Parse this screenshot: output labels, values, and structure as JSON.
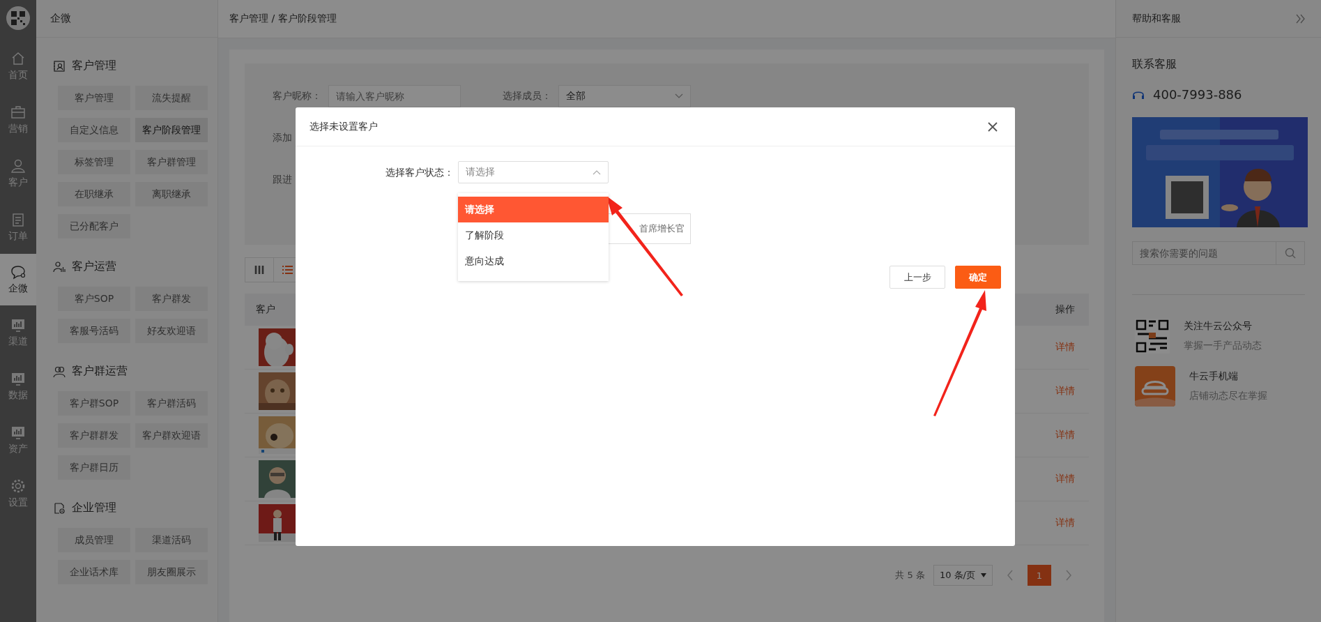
{
  "nav": {
    "items": [
      {
        "label": "首页",
        "selected": false
      },
      {
        "label": "营销",
        "selected": false
      },
      {
        "label": "客户",
        "selected": false
      },
      {
        "label": "订单",
        "selected": false
      },
      {
        "label": "企微",
        "selected": true
      },
      {
        "label": "渠道",
        "selected": false
      },
      {
        "label": "数据",
        "selected": false
      },
      {
        "label": "资产",
        "selected": false
      },
      {
        "label": "设置",
        "selected": false
      }
    ]
  },
  "sidebar": {
    "title": "企微",
    "sections": [
      {
        "title": "客户管理",
        "items": [
          {
            "label": "客户管理",
            "selected": false
          },
          {
            "label": "流失提醒",
            "selected": false
          },
          {
            "label": "自定义信息",
            "selected": false
          },
          {
            "label": "客户阶段管理",
            "selected": true
          },
          {
            "label": "标签管理",
            "selected": false
          },
          {
            "label": "客户群管理",
            "selected": false
          },
          {
            "label": "在职继承",
            "selected": false
          },
          {
            "label": "离职继承",
            "selected": false
          },
          {
            "label": "已分配客户",
            "selected": false
          }
        ]
      },
      {
        "title": "客户运营",
        "items": [
          {
            "label": "客户SOP",
            "selected": false
          },
          {
            "label": "客户群发",
            "selected": false
          },
          {
            "label": "客服号活码",
            "selected": false
          },
          {
            "label": "好友欢迎语",
            "selected": false
          }
        ]
      },
      {
        "title": "客户群运营",
        "items": [
          {
            "label": "客户群SOP",
            "selected": false
          },
          {
            "label": "客户群活码",
            "selected": false
          },
          {
            "label": "客户群群发",
            "selected": false
          },
          {
            "label": "客户群欢迎语",
            "selected": false
          },
          {
            "label": "客户群日历",
            "selected": false
          }
        ]
      },
      {
        "title": "企业管理",
        "items": [
          {
            "label": "成员管理",
            "selected": false
          },
          {
            "label": "渠道活码",
            "selected": false
          },
          {
            "label": "企业话术库",
            "selected": false
          },
          {
            "label": "朋友圈展示",
            "selected": false
          }
        ]
      }
    ]
  },
  "breadcrumb": "客户管理 / 客户阶段管理",
  "filters": [
    {
      "kind": "input",
      "label": "客户昵称：",
      "placeholder": "请输入客户昵称"
    },
    {
      "kind": "select",
      "label": "选择成员：",
      "value": "全部"
    },
    {
      "kind": "label",
      "label": "添加"
    },
    {
      "kind": "label",
      "label": "跟进"
    }
  ],
  "view_toggle": [
    {
      "selected": false
    },
    {
      "selected": true
    }
  ],
  "table": {
    "columns": [
      "客户",
      "操作"
    ],
    "rows": [
      {
        "action": "详情"
      },
      {
        "action": "详情"
      },
      {
        "action": "详情"
      },
      {
        "action": "详情"
      },
      {
        "action": "详情"
      }
    ]
  },
  "pagination": {
    "total": "共 5 条",
    "page_size": "10 条/页",
    "pages": [
      {
        "label": "1",
        "selected": true
      }
    ]
  },
  "help_panel": {
    "title": "帮助和客服",
    "contact_title": "联系客服",
    "phone": "400-7993-886",
    "search": {
      "placeholder": "搜索你需要的问题"
    },
    "links": [
      {
        "title": "关注牛云公众号",
        "subtitle": "掌握一手产品动态"
      },
      {
        "title": "牛云手机端",
        "subtitle": "店铺动态尽在掌握"
      }
    ]
  },
  "modal": {
    "title": "选择未设置客户",
    "field_label": "选择客户状态：",
    "placeholder": "请选择",
    "expanded": true,
    "tag": "首席增长官",
    "options": [
      {
        "label": "请选择",
        "selected": true
      },
      {
        "label": "了解阶段",
        "selected": false
      },
      {
        "label": "意向达成",
        "selected": false
      }
    ],
    "buttons": [
      {
        "kind": "default",
        "label": "上一步"
      },
      {
        "kind": "primary",
        "label": "确定"
      }
    ]
  }
}
